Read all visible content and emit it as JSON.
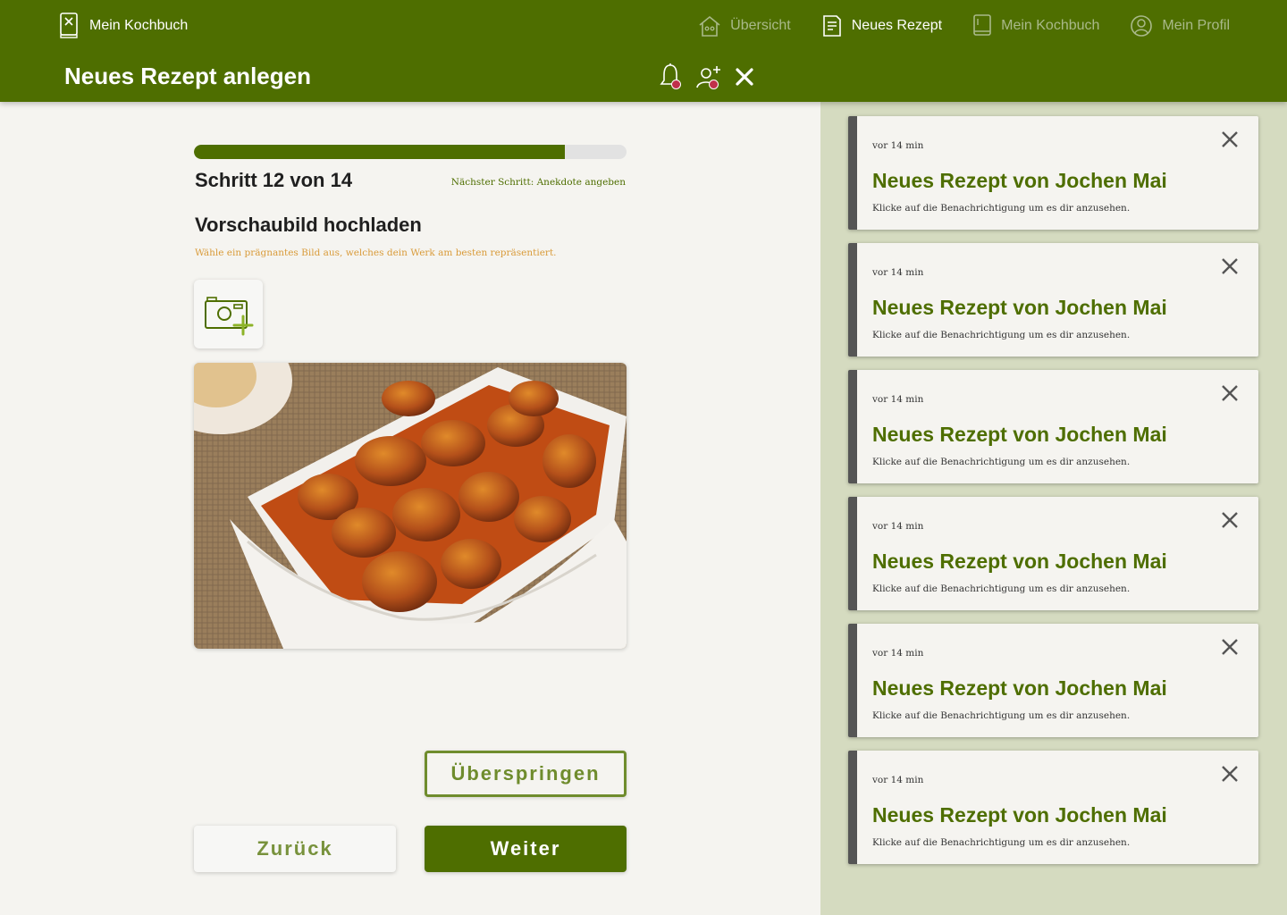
{
  "header": {
    "brand": "Mein Kochbuch",
    "page_title": "Neues Rezept anlegen",
    "nav": [
      {
        "label": "Übersicht",
        "icon": "house-icon",
        "active": false
      },
      {
        "label": "Neues Rezept",
        "icon": "recipe-note-icon",
        "active": true
      },
      {
        "label": "Mein Kochbuch",
        "icon": "book-icon",
        "active": false
      },
      {
        "label": "Mein Profil",
        "icon": "user-circle-icon",
        "active": false
      }
    ],
    "actions": [
      "bell-icon",
      "add-user-icon",
      "close-icon"
    ],
    "colors": {
      "primary": "#4e6e00",
      "inactive_nav": "#a9b98a",
      "badge": "#c0304a"
    }
  },
  "wizard": {
    "progress": 0.857,
    "step_label": "Schritt 12 von 14",
    "next_step": "Nächster Schritt: Anekdote angeben",
    "section_title": "Vorschaubild hochladen",
    "section_hint": "Wähle ein prägnantes Bild aus, welches dein Werk am besten repräsentiert.",
    "upload_icon": "camera-add-icon",
    "skip_label": "Überspringen",
    "back_label": "Zurück",
    "next_label": "Weiter"
  },
  "notifications": [
    {
      "time": "vor 14 min",
      "title": "Neues Rezept von Jochen Mai",
      "body": "Klicke auf die Benachrichtigung um es dir anzusehen."
    },
    {
      "time": "vor 14 min",
      "title": "Neues Rezept von Jochen Mai",
      "body": "Klicke auf die Benachrichtigung um es dir anzusehen."
    },
    {
      "time": "vor 14 min",
      "title": "Neues Rezept von Jochen Mai",
      "body": "Klicke auf die Benachrichtigung um es dir anzusehen."
    },
    {
      "time": "vor 14 min",
      "title": "Neues Rezept von Jochen Mai",
      "body": "Klicke auf die Benachrichtigung um es dir anzusehen."
    },
    {
      "time": "vor 14 min",
      "title": "Neues Rezept von Jochen Mai",
      "body": "Klicke auf die Benachrichtigung um es dir anzusehen."
    },
    {
      "time": "vor 14 min",
      "title": "Neues Rezept von Jochen Mai",
      "body": "Klicke auf die Benachrichtigung um es dir anzusehen."
    }
  ]
}
